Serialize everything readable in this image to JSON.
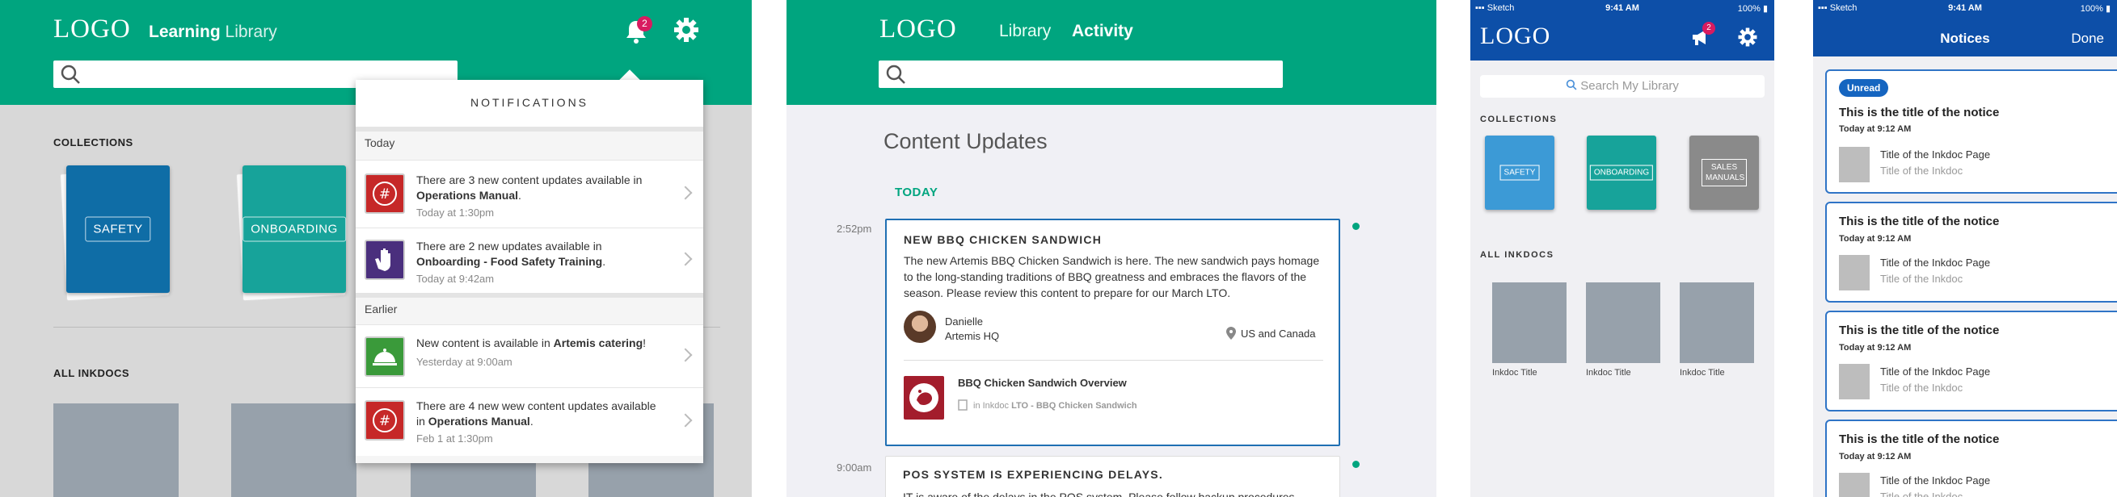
{
  "p1": {
    "logo": "LOGO",
    "nav_bold": "Learning",
    "nav_light": "Library",
    "badge": "2",
    "collections_label": "COLLECTIONS",
    "cards": [
      "SAFETY",
      "ONBOARDING"
    ],
    "all_label": "ALL INKDOCS",
    "notif": {
      "title": "NOTIFICATIONS",
      "today": "Today",
      "earlier": "Earlier",
      "items": [
        {
          "pre": "There are 3 new content updates available in ",
          "bold": "Operations Manual",
          "post": ".",
          "time": "Today at 1:30pm",
          "color": "#c62828"
        },
        {
          "pre": "There are 2 new updates available in ",
          "bold": "Onboarding - Food Safety Training",
          "post": ".",
          "time": "Today at 9:42am",
          "color": "#4a2f7d"
        },
        {
          "pre": "New content is available in ",
          "bold": "Artemis catering",
          "post": "!",
          "time": "Yesterday at 9:00am",
          "color": "#3a9a3a"
        },
        {
          "pre": "There are 4 new wew content updates available in ",
          "bold": "Operations Manual",
          "post": ".",
          "time": "Feb 1 at 1:30pm",
          "color": "#c62828"
        }
      ]
    }
  },
  "p2": {
    "logo": "LOGO",
    "nav": [
      "Library",
      "Activity"
    ],
    "heading": "Content Updates",
    "today": "TODAY",
    "entries": [
      {
        "time": "2:52pm",
        "title": "NEW BBQ CHICKEN SANDWICH",
        "body": "The new Artemis BBQ Chicken Sandwich is here. The new sandwich pays homage to the long-standing traditions of BBQ greatness and embraces the flavors of the season. Please review this content to prepare for our March LTO.",
        "author": "Danielle",
        "org": "Artemis HQ",
        "region": "US and Canada",
        "link_title": "BBQ Chicken Sandwich Overview",
        "link_prefix": "in Inkdoc ",
        "link_bold": "LTO - BBQ Chicken Sandwich"
      },
      {
        "time": "9:00am",
        "title": "POS SYSTEM IS EXPERIENCING DELAYS.",
        "body": "IT is aware of the delays in the POS system. Please follow backup procedures found in"
      }
    ]
  },
  "p3": {
    "status_left": "Sketch",
    "status_time": "9:41 AM",
    "status_batt": "100%",
    "logo": "LOGO",
    "badge": "2",
    "search_placeholder": "Search My Library",
    "collections_label": "COLLECTIONS",
    "cards": [
      {
        "label": "SAFETY",
        "color": "#3c9ad6"
      },
      {
        "label": "ONBOARDING",
        "color": "#17a39a"
      },
      {
        "label": "SALES MANUALS",
        "color": "#8a8a8a"
      }
    ],
    "all_label": "ALL INKDOCS",
    "docs": [
      "Inkdoc Title",
      "Inkdoc Title",
      "Inkdoc Title"
    ]
  },
  "p4": {
    "status_left": "Sketch",
    "status_time": "9:41 AM",
    "status_batt": "100%",
    "title": "Notices",
    "done": "Done",
    "unread": "Unread",
    "notices": [
      {
        "title": "This is the title of the notice",
        "time": "Today at 9:12 AM",
        "page": "Title of the Inkdoc Page",
        "doc": "Title of the Inkdoc"
      },
      {
        "title": "This is the title of the notice",
        "time": "Today at 9:12 AM",
        "page": "Title of the Inkdoc Page",
        "doc": "Title of the Inkdoc"
      },
      {
        "title": "This is the title of the notice",
        "time": "Today at 9:12 AM",
        "page": "Title of the Inkdoc Page",
        "doc": "Title of the Inkdoc"
      },
      {
        "title": "This is the title of the notice",
        "time": "Today at 9:12 AM",
        "page": "Title of the Inkdoc Page",
        "doc": "Title of the Inkdoc"
      }
    ]
  }
}
